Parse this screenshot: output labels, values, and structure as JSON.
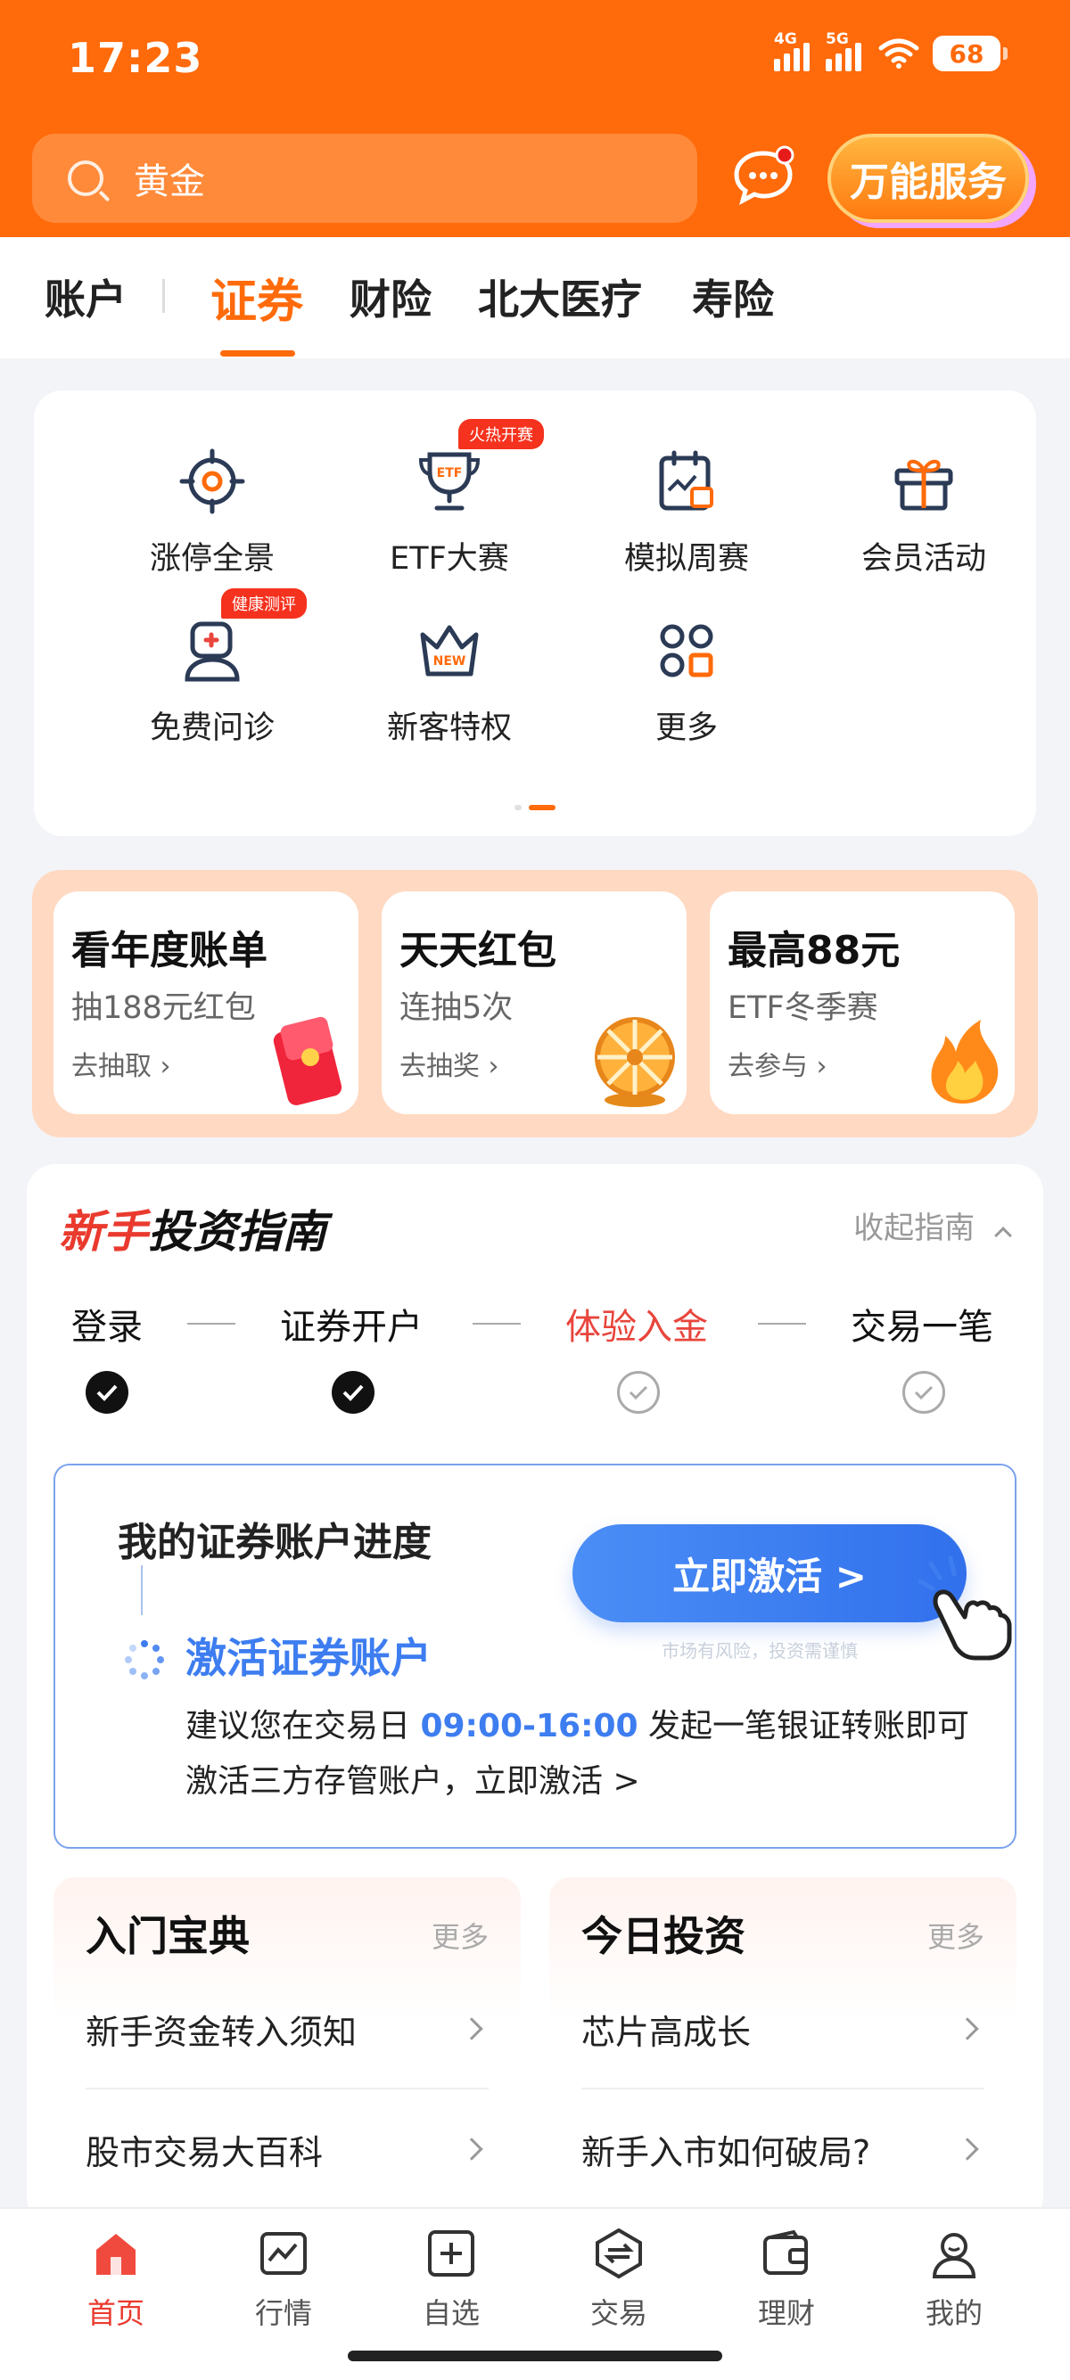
{
  "status_bar": {
    "time": "17:23",
    "net1": "4G",
    "net2": "5G",
    "battery": "68"
  },
  "search": {
    "placeholder": "黄金"
  },
  "header": {
    "service_label": "万能服务"
  },
  "top_tabs": [
    {
      "label": "账户"
    },
    {
      "label": "证券",
      "active": true
    },
    {
      "label": "财险"
    },
    {
      "label": "北大医疗"
    },
    {
      "label": "寿险"
    }
  ],
  "quick_grid": {
    "items": [
      {
        "label": "涨停全景",
        "icon": "target-icon"
      },
      {
        "label": "ETF大赛",
        "icon": "etf-trophy-icon",
        "badge": "火热开赛"
      },
      {
        "label": "模拟周赛",
        "icon": "calendar-chart-icon"
      },
      {
        "label": "会员活动",
        "icon": "gift-icon"
      },
      {
        "label": "免费问诊",
        "icon": "doctor-icon",
        "badge": "健康测评"
      },
      {
        "label": "新客特权",
        "icon": "crown-new-icon"
      },
      {
        "label": "更多",
        "icon": "grid-more-icon"
      }
    ]
  },
  "promos": [
    {
      "title": "看年度账单",
      "sub": "抽188元红包",
      "cta": "去抽取 ›"
    },
    {
      "title": "天天红包",
      "sub": "连抽5次",
      "cta": "去抽奖 ›"
    },
    {
      "title": "最高88元",
      "sub": "ETF冬季赛",
      "cta": "去参与 ›"
    }
  ],
  "guide": {
    "title_red": "新手",
    "title_black": "投资指南",
    "collapse_label": "收起指南",
    "steps": [
      {
        "label": "登录",
        "done": true
      },
      {
        "label": "证券开户",
        "done": true
      },
      {
        "label": "体验入金",
        "done": false,
        "current": true
      },
      {
        "label": "交易一笔",
        "done": false
      }
    ],
    "progress": {
      "title": "我的证券账户进度",
      "step_label": "激活证券账户",
      "desc_before": "建议您在交易日 ",
      "desc_time": "09:00-16:00",
      "desc_after": " 发起一笔银证转账即可激活三方存管账户，立即激活 >",
      "button": "立即激活 >",
      "risk_note": "市场有风险，投资需谨慎"
    },
    "intro": {
      "title": "入门宝典",
      "more": "更多",
      "items": [
        "新手资金转入须知",
        "股市交易大百科"
      ]
    },
    "today": {
      "title": "今日投资",
      "more": "更多",
      "items": [
        "芯片高成长",
        "新手入市如何破局?"
      ]
    }
  },
  "bottom_nav": [
    {
      "label": "首页",
      "icon": "home-icon",
      "active": true
    },
    {
      "label": "行情",
      "icon": "market-chart-icon"
    },
    {
      "label": "自选",
      "icon": "add-watchlist-icon"
    },
    {
      "label": "交易",
      "icon": "trade-exchange-icon"
    },
    {
      "label": "理财",
      "icon": "wallet-icon"
    },
    {
      "label": "我的",
      "icon": "profile-icon"
    }
  ],
  "colors": {
    "brand_orange": "#ff6a0a",
    "accent_red": "#ea3a2e",
    "accent_blue": "#3d7df0"
  }
}
